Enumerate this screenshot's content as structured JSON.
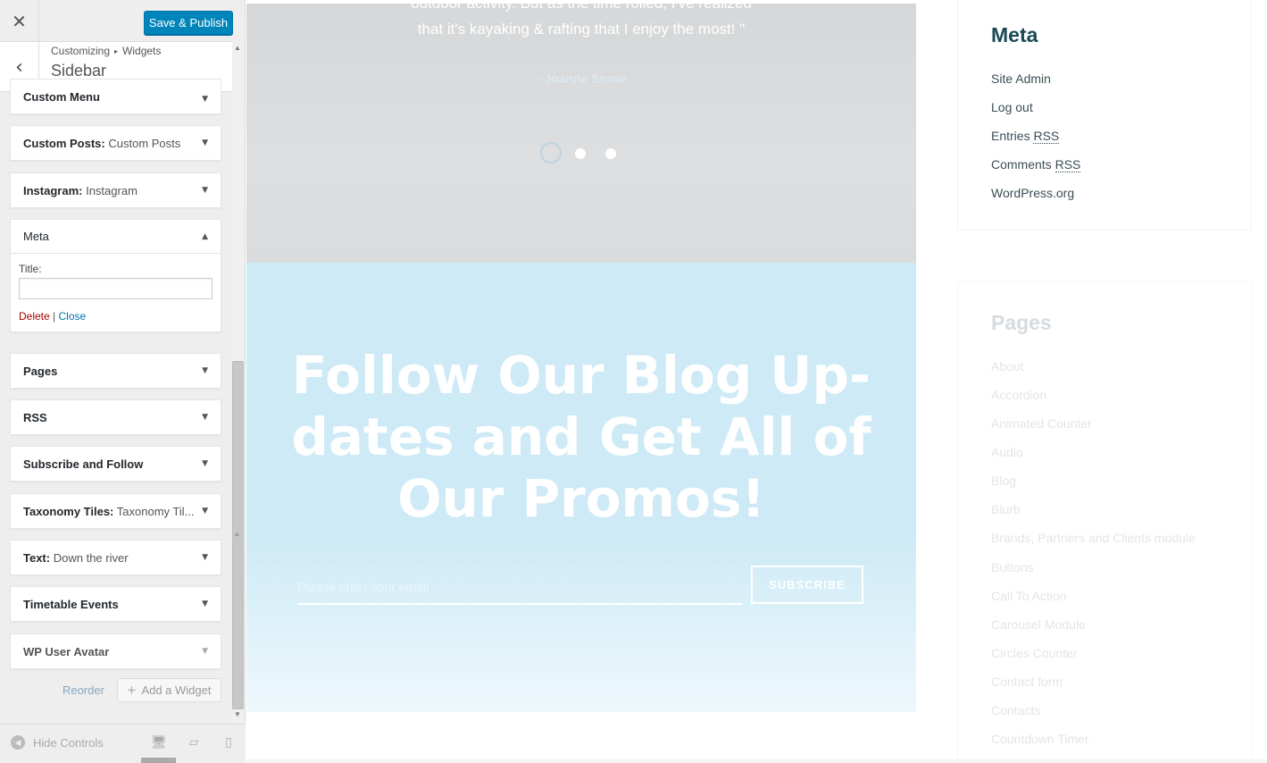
{
  "customizer": {
    "close_icon": "close-icon",
    "publish_label": "Save & Publish",
    "breadcrumb": [
      "Customizing",
      "Widgets"
    ],
    "section_title": "Sidebar",
    "widgets": [
      {
        "name": "Custom Menu",
        "subtitle": ""
      },
      {
        "name": "Custom Posts:",
        "subtitle": "Custom Posts"
      },
      {
        "name": "Instagram:",
        "subtitle": "Instagram"
      },
      {
        "name": "Meta",
        "subtitle": ""
      },
      {
        "name": "Pages",
        "subtitle": ""
      },
      {
        "name": "RSS",
        "subtitle": ""
      },
      {
        "name": "Subscribe and Follow",
        "subtitle": ""
      },
      {
        "name": "Taxonomy Tiles:",
        "subtitle": "Taxonomy Til..."
      },
      {
        "name": "Text:",
        "subtitle": "Down the river"
      },
      {
        "name": "Timetable Events",
        "subtitle": ""
      },
      {
        "name": "WP User Avatar",
        "subtitle": ""
      }
    ],
    "meta_form": {
      "title_label": "Title:",
      "title_value": "",
      "delete_label": "Delete",
      "separator": "|",
      "close_label": "Close"
    },
    "reorder_label": "Reorder",
    "add_widget_label": "Add a Widget",
    "hide_controls_label": "Hide Controls",
    "accent_color": "#0085ba"
  },
  "preview": {
    "quote_line1": "outdoor activity. But as the time rolled, I've realized",
    "quote_line2": "that it's kayaking & rafting that I enjoy the most! \"",
    "quote_author": "- Joanne Stone",
    "slider_active": 1,
    "slider_total": 3,
    "subscribe": {
      "heading": "Follow Our Blog Up-dates and Get All of Our Promos!",
      "email_placeholder": "Please enter your email",
      "button_label": "SUBSCRIBE"
    },
    "meta": {
      "heading": "Meta",
      "links": [
        "Site Admin",
        "Log out",
        "Entries",
        "Comments",
        "WordPress.org"
      ],
      "rss_abbr": "RSS"
    },
    "pages": {
      "heading": "Pages",
      "links": [
        "About",
        "Accordion",
        "Animated Counter",
        "Audio",
        "Blog",
        "Blurb",
        "Brands, Partners and Clients module",
        "Buttons",
        "Call To Action",
        "Carousel Module",
        "Circles Counter",
        "Contact form",
        "Contacts",
        "Countdown Timer"
      ]
    }
  }
}
